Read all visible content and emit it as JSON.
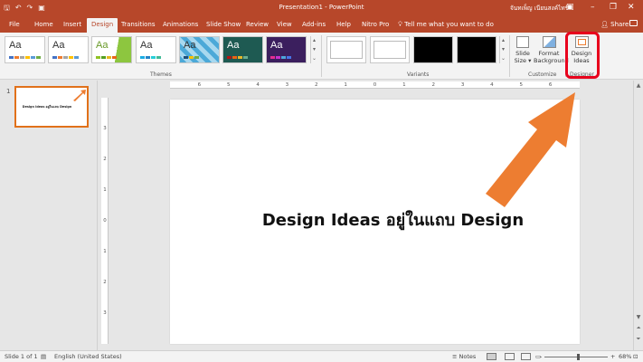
{
  "titlebar": {
    "title": "Presentation1 - PowerPoint",
    "user": "จันทเพ็ญ เนียนสงค์ไทร์",
    "qat_icons": [
      "save-icon",
      "undo-icon",
      "redo-icon",
      "start-icon"
    ]
  },
  "tabs": [
    {
      "label": "File",
      "active": false
    },
    {
      "label": "Home",
      "active": false
    },
    {
      "label": "Insert",
      "active": false
    },
    {
      "label": "Design",
      "active": true
    },
    {
      "label": "Transitions",
      "active": false
    },
    {
      "label": "Animations",
      "active": false
    },
    {
      "label": "Slide Show",
      "active": false
    },
    {
      "label": "Review",
      "active": false
    },
    {
      "label": "View",
      "active": false
    },
    {
      "label": "Add-ins",
      "active": false
    },
    {
      "label": "Help",
      "active": false
    },
    {
      "label": "Nitro Pro",
      "active": false
    }
  ],
  "tell_me": "Tell me what you want to do",
  "share": "Share",
  "ribbon": {
    "themes_label": "Themes",
    "variants_label": "Variants",
    "customize_label": "Customize",
    "designer_label": "Designer",
    "theme_text": "Aa",
    "slide_size": {
      "line1": "Slide",
      "line2": "Size ▾"
    },
    "format_background": {
      "line1": "Format",
      "line2": "Background"
    },
    "design_ideas": {
      "line1": "Design",
      "line2": "Ideas"
    }
  },
  "slide_panel": {
    "number": "1",
    "thumb_text": "Design Ideas อยู่ในแถบ Design"
  },
  "slide": {
    "headline": "Design Ideas อยู่ในแถบ Design"
  },
  "ruler": {
    "h_ticks": [
      "6",
      "5",
      "4",
      "3",
      "2",
      "1",
      "0",
      "1",
      "2",
      "3",
      "4",
      "5",
      "6"
    ],
    "v_ticks": [
      "3",
      "2",
      "1",
      "0",
      "1",
      "2",
      "3"
    ]
  },
  "statusbar": {
    "slide_info": "Slide 1 of 1",
    "language": "English (United States)",
    "notes": "Notes",
    "zoom_minus": "-",
    "zoom_plus": "+",
    "zoom_level": "68%"
  },
  "colors": {
    "accent": "#b7472a",
    "highlight": "#e8001c",
    "arrow": "#ed7d31"
  }
}
